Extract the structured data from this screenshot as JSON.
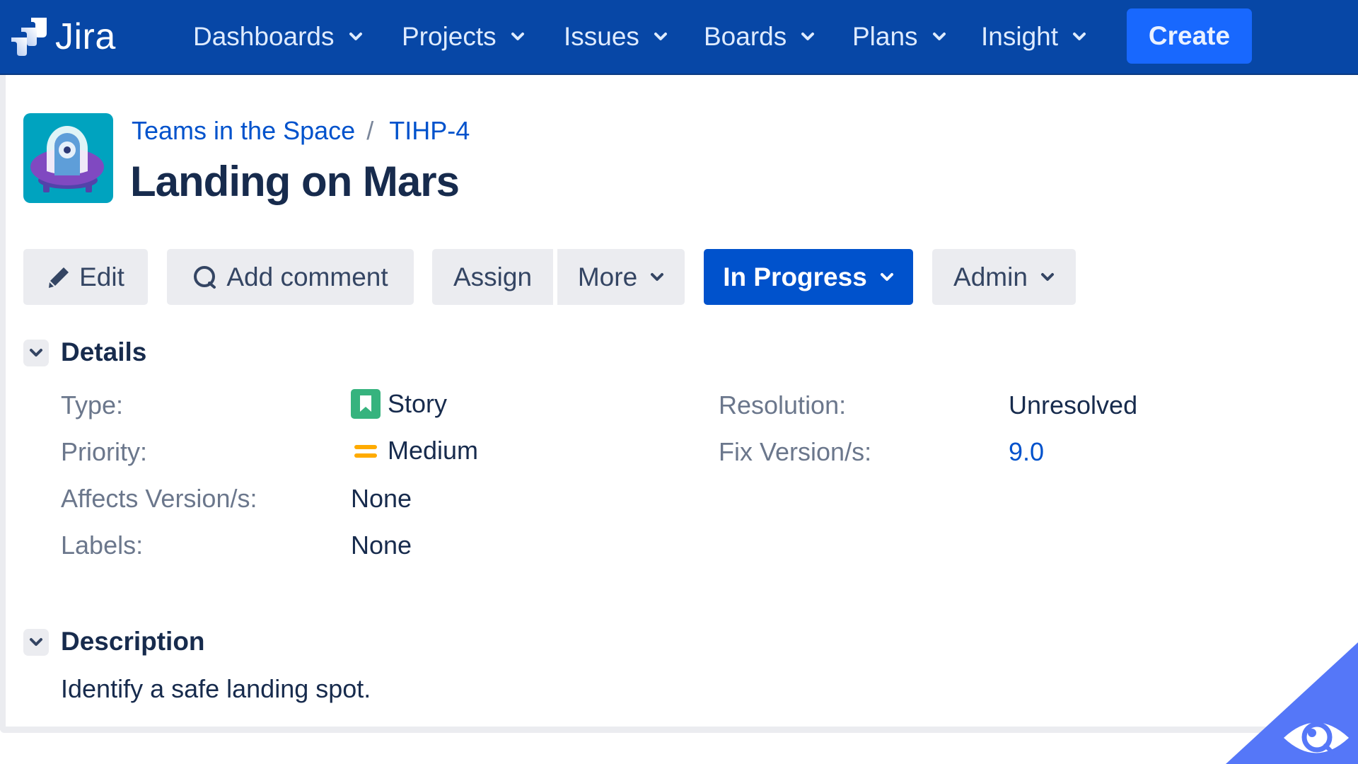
{
  "app": {
    "name": "Jira"
  },
  "nav": {
    "items": [
      {
        "label": "Dashboards"
      },
      {
        "label": "Projects"
      },
      {
        "label": "Issues"
      },
      {
        "label": "Boards"
      },
      {
        "label": "Plans"
      },
      {
        "label": "Insight"
      }
    ],
    "create_label": "Create"
  },
  "issue": {
    "project": "Teams in the Space",
    "separator": "/",
    "key": "TIHP-4",
    "title": "Landing on Mars"
  },
  "toolbar": {
    "edit": "Edit",
    "add_comment": "Add comment",
    "assign": "Assign",
    "more": "More",
    "status": "In Progress",
    "admin": "Admin"
  },
  "details": {
    "heading": "Details",
    "left": [
      {
        "label": "Type:",
        "value": "Story",
        "icon": "story-icon"
      },
      {
        "label": "Priority:",
        "value": "Medium",
        "icon": "priority-medium-icon"
      },
      {
        "label": "Affects Version/s:",
        "value": "None"
      },
      {
        "label": "Labels:",
        "value": "None"
      }
    ],
    "right": [
      {
        "label": "Resolution:",
        "value": "Unresolved"
      },
      {
        "label": "Fix Version/s:",
        "value": "9.0",
        "link": true
      }
    ]
  },
  "description": {
    "heading": "Description",
    "text": "Identify a safe landing spot."
  },
  "colors": {
    "header": "#0747a6",
    "primary": "#0052cc",
    "create": "#1868fe",
    "story": "#36b37e",
    "priority_medium": "#ffab00",
    "corner_badge": "#5577f8"
  }
}
